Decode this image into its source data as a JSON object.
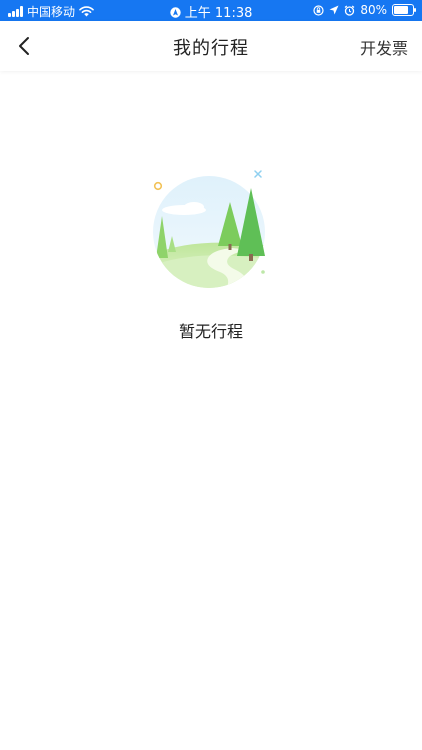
{
  "status_bar": {
    "carrier": "中国移动",
    "time": "上午 11:38",
    "battery_text": "80%",
    "battery_level": 0.8,
    "background": "#1677f2"
  },
  "nav": {
    "title": "我的行程",
    "action_label": "开发票",
    "back_icon": "chevron-left-icon"
  },
  "empty_state": {
    "message": "暂无行程",
    "illustration": "forest-landscape-illustration"
  }
}
